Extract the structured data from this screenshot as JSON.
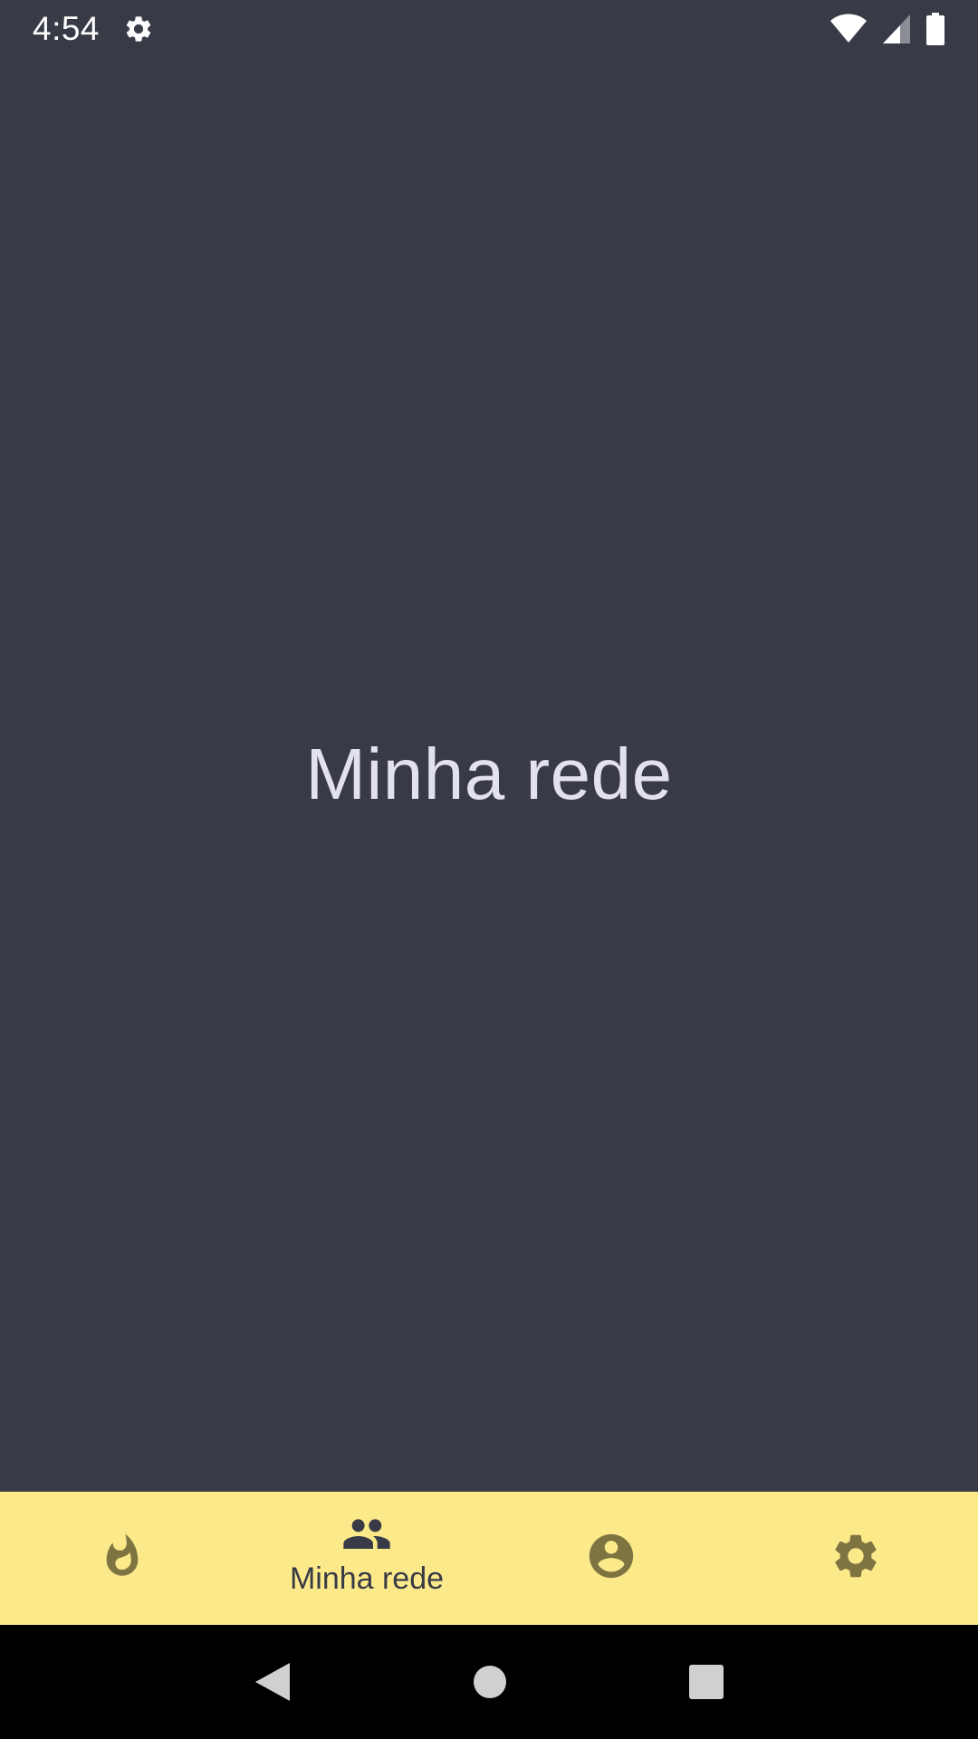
{
  "status_bar": {
    "time": "4:54",
    "settings_icon": "gear-icon",
    "wifi_icon": "wifi-icon",
    "signal_icon": "cellular-signal-icon",
    "battery_icon": "battery-icon"
  },
  "main": {
    "title": "Minha rede"
  },
  "bottom_nav": {
    "items": [
      {
        "icon": "flame-icon",
        "label": ""
      },
      {
        "icon": "people-icon",
        "label": "Minha rede",
        "active": true
      },
      {
        "icon": "account-circle-icon",
        "label": ""
      },
      {
        "icon": "gear-icon",
        "label": ""
      }
    ]
  },
  "system_nav": {
    "back": "back-triangle-icon",
    "home": "home-circle-icon",
    "recents": "recents-square-icon"
  },
  "colors": {
    "background": "#383b46",
    "bottom_nav_background": "#fbe98a",
    "inactive_icon": "#7d7442",
    "active_icon": "#383b46",
    "title_text": "#e3e1ee"
  }
}
